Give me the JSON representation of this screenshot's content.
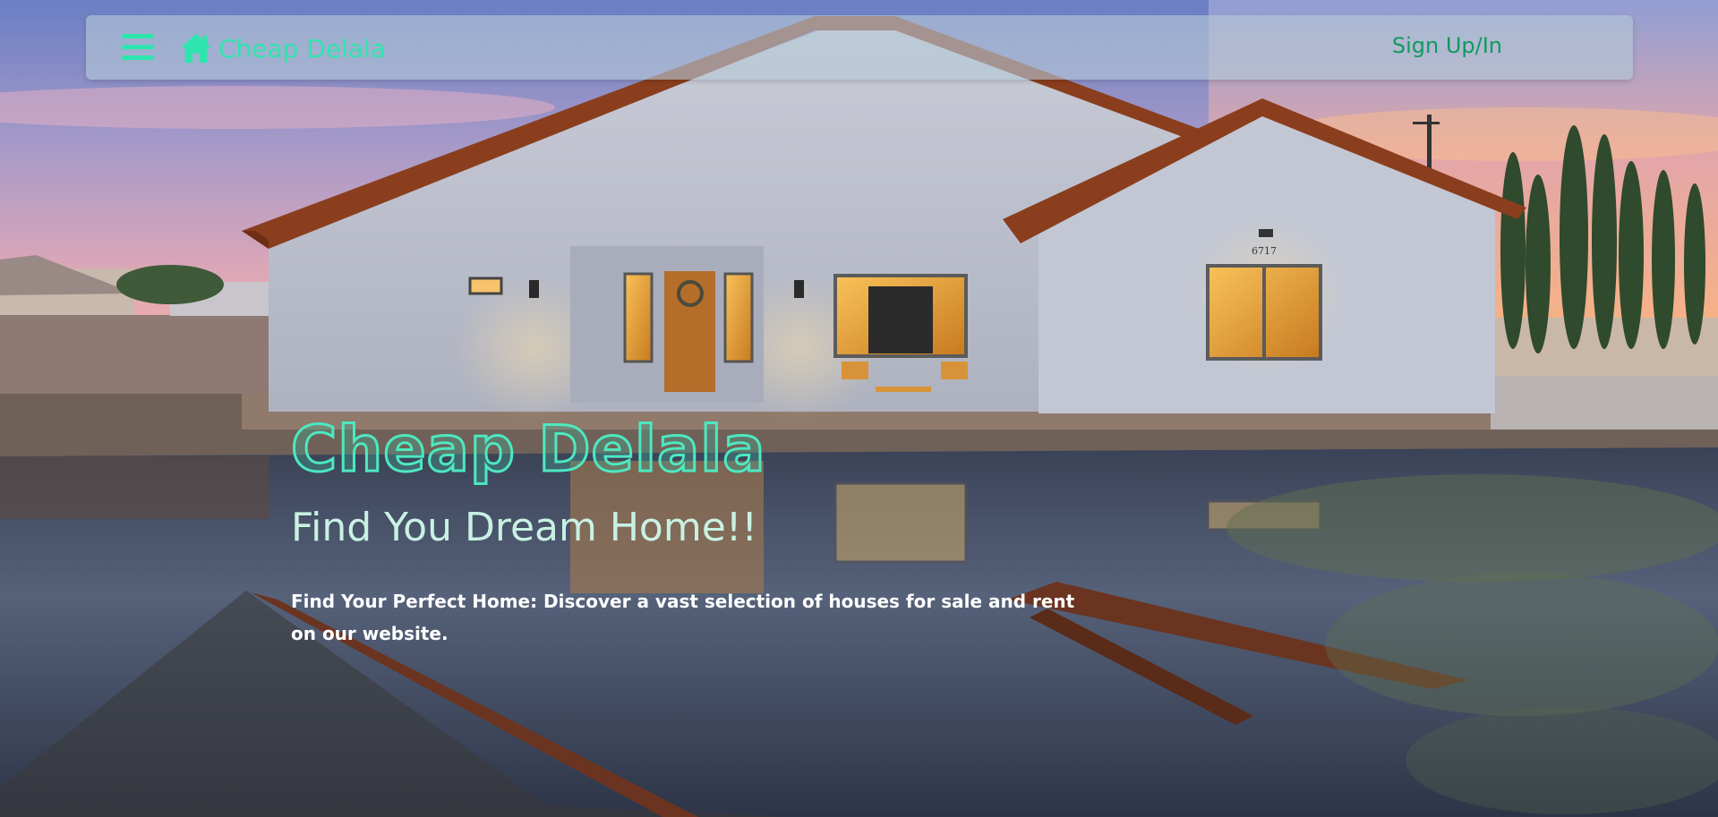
{
  "navbar": {
    "menu_icon": "hamburger-menu-icon",
    "home_icon": "home-icon",
    "brand_name": "Cheap Delala",
    "signup_label": "Sign Up/In"
  },
  "hero": {
    "title": "Cheap Delala",
    "subtitle": "Find You Dream Home!!",
    "description": "Find Your Perfect Home: Discover a vast selection of houses for sale and rent on our website."
  },
  "house_number": "6717",
  "colors": {
    "accent": "#2ee6ad",
    "signup": "#0f9a5e",
    "subtitle": "#c8f1e3"
  }
}
